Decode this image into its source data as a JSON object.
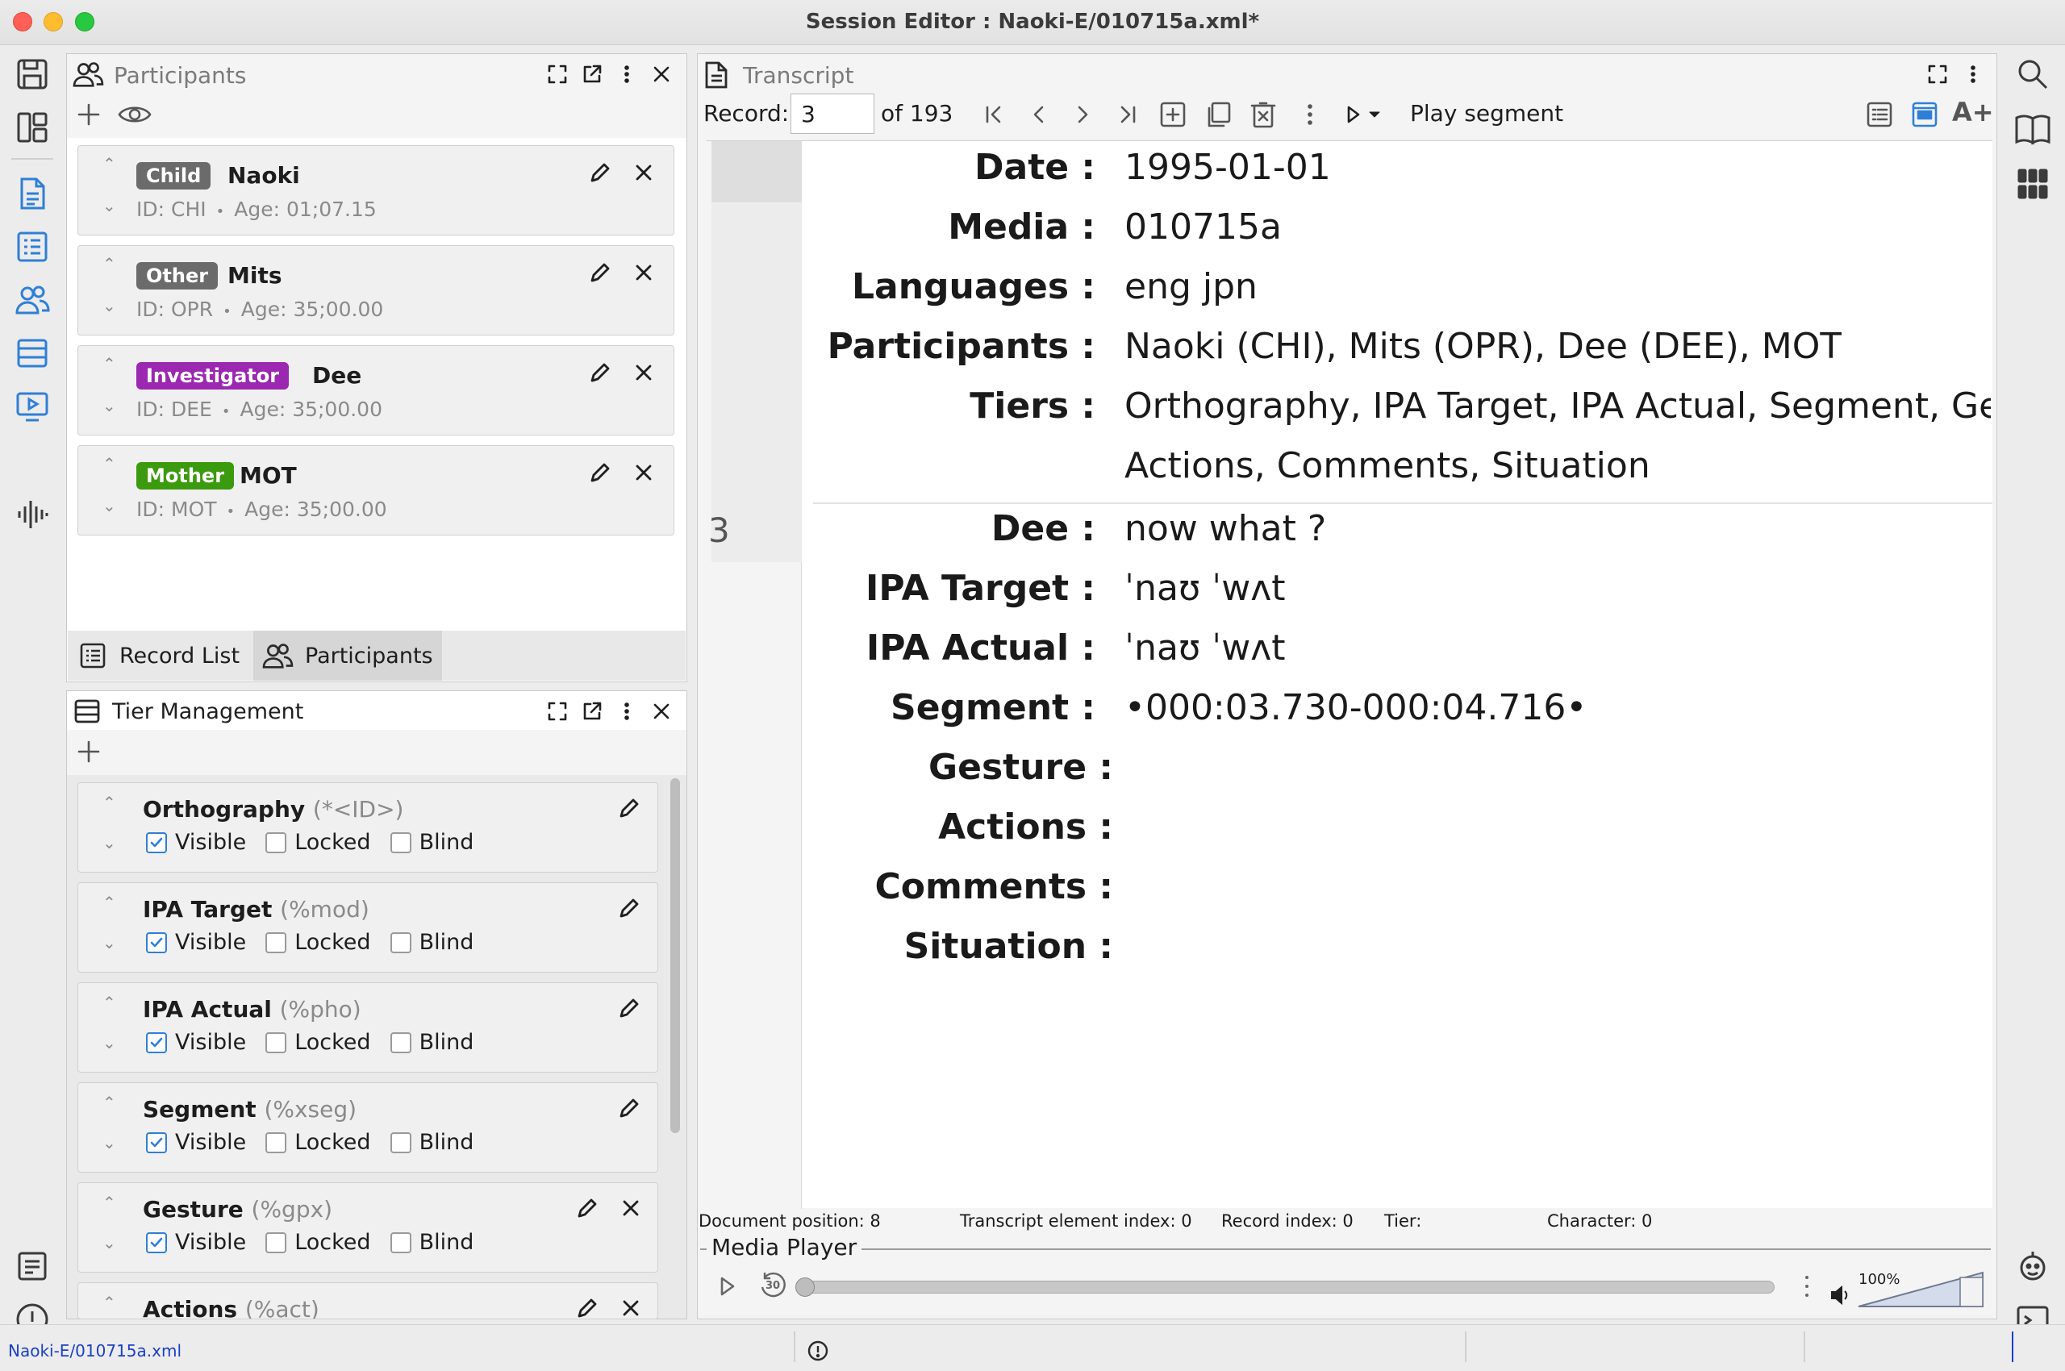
{
  "window": {
    "title": "Session Editor : Naoki-E/010715a.xml*"
  },
  "participants_panel": {
    "title": "Participants",
    "items": [
      {
        "role": "Child",
        "role_color": "#6b6b6b",
        "name": "Naoki",
        "id": "ID: CHI",
        "age": "Age: 01;07.15"
      },
      {
        "role": "Other",
        "role_color": "#6b6b6b",
        "name": "Mits",
        "id": "ID: OPR",
        "age": "Age: 35;00.00"
      },
      {
        "role": "Investigator",
        "role_color": "#9c27b0",
        "name": "Dee",
        "id": "ID: DEE",
        "age": "Age: 35;00.00"
      },
      {
        "role": "Mother",
        "role_color": "#3c9a0e",
        "name": "MOT",
        "id": "ID: MOT",
        "age": "Age: 35;00.00"
      }
    ],
    "tabs": [
      "Record List",
      "Participants"
    ],
    "meta_sep": "•"
  },
  "tier_panel": {
    "title": "Tier Management",
    "check_labels": {
      "visible": "Visible",
      "locked": "Locked",
      "blind": "Blind"
    },
    "tiers": [
      {
        "name": "Orthography",
        "code": "(*<ID>)",
        "visible": true,
        "locked": false,
        "blind": false
      },
      {
        "name": "IPA Target",
        "code": "(%mod)",
        "visible": true,
        "locked": false,
        "blind": false
      },
      {
        "name": "IPA Actual",
        "code": "(%pho)",
        "visible": true,
        "locked": false,
        "blind": false
      },
      {
        "name": "Segment",
        "code": "(%xseg)",
        "visible": true,
        "locked": false,
        "blind": false
      },
      {
        "name": "Gesture",
        "code": "(%gpx)",
        "visible": true,
        "locked": false,
        "blind": false
      },
      {
        "name": "Actions",
        "code": "(%act)"
      }
    ]
  },
  "transcript": {
    "title": "Transcript",
    "record_label": "Record:",
    "record_value": "3",
    "of_label": "of 193",
    "play_label": "Play segment",
    "header": [
      {
        "label": "Date :",
        "value": "1995-01-01"
      },
      {
        "label": "Media :",
        "value": "010715a"
      },
      {
        "label": "Languages :",
        "value": "eng jpn"
      },
      {
        "label": "Participants :",
        "value": "Naoki (CHI), Mits (OPR), Dee (DEE), MOT"
      },
      {
        "label": "Tiers :",
        "value": "Orthography, IPA Target, IPA Actual, Segment, Gestu"
      }
    ],
    "tiers_continued": "Actions, Comments, Situation",
    "record_number": "3",
    "record": [
      {
        "label": "Dee :",
        "value": "now what ?"
      },
      {
        "label": "IPA Target :",
        "value": "ˈnaʊ ˈwʌt"
      },
      {
        "label": "IPA Actual :",
        "value": "ˈnaʊ ˈwʌt"
      },
      {
        "label": "Segment :",
        "value": "•000:03.730-000:04.716•"
      },
      {
        "label": "Gesture :",
        "value": ""
      },
      {
        "label": "Actions :",
        "value": ""
      },
      {
        "label": "Comments :",
        "value": ""
      },
      {
        "label": "Situation :",
        "value": ""
      }
    ],
    "status": {
      "doc_pos": "Document position: 8",
      "elem_index": "Transcript element index: 0",
      "record_index": "Record index: 0",
      "tier": "Tier:",
      "character": "Character: 0"
    }
  },
  "media_player": {
    "title": "Media Player",
    "volume": "100%",
    "skip_seconds": "30"
  },
  "footer": {
    "path": "Naoki-E/010715a.xml"
  },
  "colors": {
    "accent": "#2f7fd6",
    "investigator": "#9c27b0",
    "mother": "#3c9a0e"
  }
}
